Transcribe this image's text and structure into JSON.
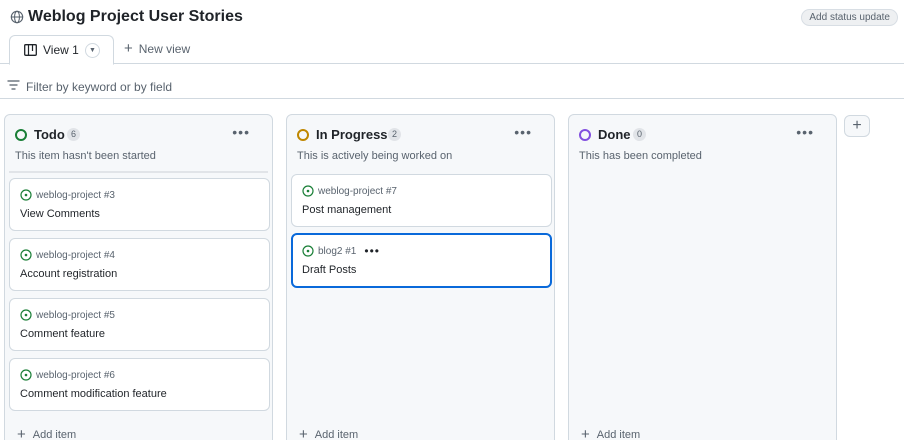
{
  "header": {
    "title": "Weblog Project User Stories",
    "status_button": "Add status update"
  },
  "tabs": [
    {
      "label": "View 1"
    }
  ],
  "new_view_label": "New view",
  "filter": {
    "placeholder": "Filter by keyword or by field"
  },
  "columns": [
    {
      "name": "Todo",
      "count": "6",
      "description": "This item hasn't been started",
      "status_color": "#1a7f37",
      "cards": [
        {
          "repo": "weblog-project #3",
          "title": "View Comments"
        },
        {
          "repo": "weblog-project #4",
          "title": "Account registration"
        },
        {
          "repo": "weblog-project #5",
          "title": "Comment feature"
        },
        {
          "repo": "weblog-project #6",
          "title": "Comment modification feature"
        }
      ],
      "add_item": "Add item"
    },
    {
      "name": "In Progress",
      "count": "2",
      "description": "This is actively being worked on",
      "status_color": "#bf8700",
      "cards": [
        {
          "repo": "weblog-project #7",
          "title": "Post management"
        },
        {
          "repo": "blog2 #1",
          "title": "Draft Posts",
          "selected": true
        }
      ],
      "add_item": "Add item"
    },
    {
      "name": "Done",
      "count": "0",
      "description": "This has been completed",
      "status_color": "#8250df",
      "cards": [],
      "add_item": "Add item"
    }
  ],
  "icons": {
    "title": "globe-icon",
    "tab": "board-icon",
    "filter": "filter-icon",
    "card": "open-issue-icon",
    "add": "plus-icon",
    "menu": "kebab-menu-icon"
  },
  "colors": {
    "issue_open": "#1a7f37",
    "selected_border": "#0969da"
  }
}
